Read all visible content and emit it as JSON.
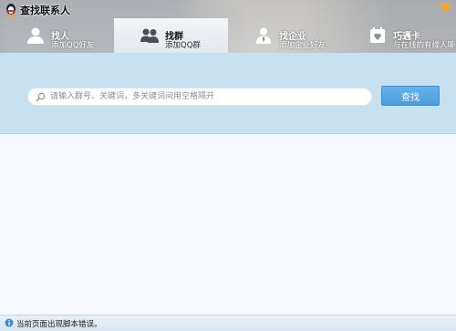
{
  "window": {
    "title": "查找联系人"
  },
  "tabs": [
    {
      "title": "找人",
      "subtitle": "添加QQ好友",
      "icon": "person-icon",
      "active": false
    },
    {
      "title": "找群",
      "subtitle": "添加QQ群",
      "icon": "group-icon",
      "active": true
    },
    {
      "title": "找企业",
      "subtitle": "添加企业好友",
      "icon": "enterprise-person-icon",
      "active": false
    },
    {
      "title": "巧遇卡",
      "subtitle": "与在线的有缘人聊天",
      "icon": "card-icon",
      "active": false
    }
  ],
  "search": {
    "placeholder": "请输入群号、关键词，多关键词间用空格隔开",
    "value": "",
    "button_label": "查找"
  },
  "status_bar": {
    "text": "当前页面出现脚本错误。"
  },
  "colors": {
    "search_band": "#c8e1f1",
    "button": "#4a9ede",
    "content_bg": "#f5f9fd"
  }
}
